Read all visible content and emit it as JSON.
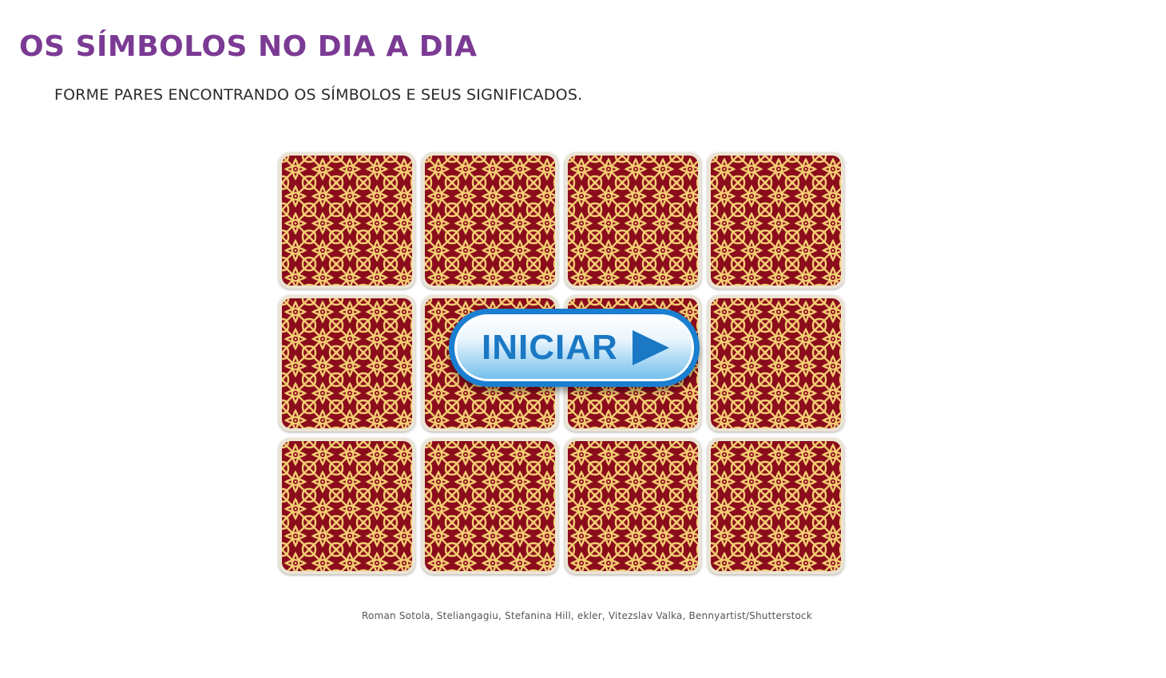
{
  "header": {
    "title": "OS SÍMBOLOS NO DIA A DIA",
    "instructions": "FORME PARES ENCONTRANDO OS SÍMBOLOS E SEUS SIGNIFICADOS."
  },
  "game": {
    "type": "memory-game",
    "grid": {
      "rows": 3,
      "columns": 4
    },
    "card_back_colors": {
      "background": "#8b0d1c",
      "pattern": "#f3cd73"
    },
    "cards": [
      {
        "id": 1,
        "state": "face-down"
      },
      {
        "id": 2,
        "state": "face-down"
      },
      {
        "id": 3,
        "state": "face-down"
      },
      {
        "id": 4,
        "state": "face-down"
      },
      {
        "id": 5,
        "state": "face-down"
      },
      {
        "id": 6,
        "state": "face-down"
      },
      {
        "id": 7,
        "state": "face-down"
      },
      {
        "id": 8,
        "state": "face-down"
      },
      {
        "id": 9,
        "state": "face-down"
      },
      {
        "id": 10,
        "state": "face-down"
      },
      {
        "id": 11,
        "state": "face-down"
      },
      {
        "id": 12,
        "state": "face-down"
      }
    ],
    "start_button": {
      "label": "INICIAR",
      "icon": "play-icon",
      "color": "#1a78c4"
    }
  },
  "footer": {
    "credits": "Roman Sotola, Steliangagiu, Stefanina Hill, ekler, Vitezslav Valka, Bennyartist/Shutterstock"
  },
  "colors": {
    "title": "#7b3a93",
    "text": "#2a2a2a",
    "card_border": "#ece4d3"
  }
}
